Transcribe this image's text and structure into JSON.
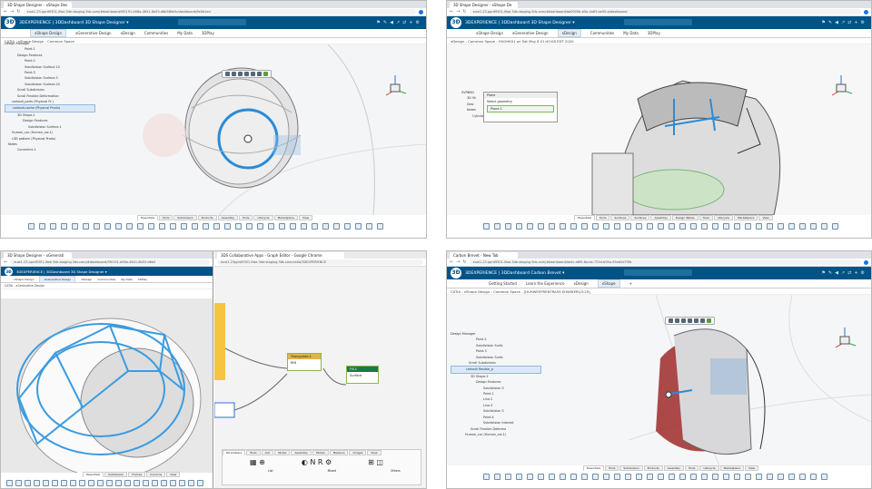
{
  "q1": {
    "browser_tab": "3D Shape Designer - xShape Des",
    "url": "euw1-23.pprd9301-ifwe.3de.staging.3ds.com/#dashboard/5f0191-b56a-4641-8a53-d6b58fa9c/dashboard/6e0b1ed",
    "brand": "3DEXPERIENCE | 3DDashboard  3D Shape Designer ▾",
    "tabs": [
      "xShape Design",
      "xGenerative Design",
      "xDesign",
      "Communities",
      "My Data",
      "3DPlay"
    ],
    "active_tab": "xShape Design",
    "subbar": "CATIA - xShape Design - Common Space",
    "tree": [
      "Design Manager",
      "Point.1",
      "Design Features",
      "Point.2",
      "Subdivision Surface.14",
      "Point.3",
      "Subdivision Surface.3",
      "Subdivision Surface.24",
      "Scroll Subdivision",
      "Scroll Flexible Deformation",
      "carbodi_parts (Physical Pr.)",
      "carbodi-cache (Physical Produ)",
      "3D Shape.1",
      "Design Features",
      "Subdivision Surface.1",
      "Human_car (Human_car.1)",
      "c3D pattern (Physical Produ)",
      "Notes",
      "Cornerlink.1"
    ],
    "bottom_tabs": [
      "Essentials",
      "Tools",
      "Subdivision",
      "Products",
      "Assembly",
      "Tools",
      "Lifecycle",
      "Marketplace",
      "View"
    ]
  },
  "q2": {
    "browser_tab": "3D Shape Designer - xShape De",
    "url": "euw1-23.pprd9301-ifwe.3de.staging.3ds.com/#dashboard/da9005b-b5a-4a63-ae90-e/dashboard",
    "brand": "3DEXPERIENCE | 3DDashboard  3D Shape Designer ▾",
    "tabs": [
      "xShape Design",
      "xGenerative Design",
      "xDesign",
      "Communities",
      "My Data",
      "3DPlay"
    ],
    "active_tab": "xDesign",
    "subbar": "xDesign - Common Space - HUGHK01 on Sat May 8 01:40:08 EDT 2020",
    "tree": [
      "SVRB0D",
      "3D Sh",
      "Desi",
      "Notes",
      "Cylinder.1"
    ],
    "panel_title": "Plane",
    "panel_rows": [
      "Select geometry",
      "Plane.1"
    ],
    "bottom_tabs": [
      "Essentials",
      "Tools",
      "Surfaces",
      "Surfaces",
      "Assembly",
      "Design Tables",
      "Tools",
      "Lifecycle",
      "Marketplace",
      "View"
    ]
  },
  "q3": {
    "browser_tab": "3D Shape Designer - xGenerati",
    "url": "euw1-23.pprd9301-ifwe.3de.staging.3ds.com/#dashboard/5f0191-b56a-4641-8a53-d6b5",
    "brand": "3DEXPERIENCE | 3DDashboard  3D Shape Designer ▾",
    "tabs": [
      "xShape Design",
      "xGenerative Design",
      "xDesign",
      "Communities",
      "My Data",
      "3DPlay"
    ],
    "active_tab": "xGenerative Design",
    "subbar": "CATIA - xGenerative Design",
    "graph_window_tab": "3DS Collaborative Apps - Graph Editor - Google Chrome",
    "graph_url": "euw1-23pprd9301-ifwe.3de.staging.3ds.com/catia/3DEXPERIENCE",
    "nodes": [
      {
        "title": "Triangulate.1",
        "label": "RIN"
      },
      {
        "title": "Fill.1",
        "label": "Surface"
      }
    ],
    "bottom_tabs": [
      "Parameters",
      "Tools",
      "List",
      "Vertex",
      "Assembly",
      "Modes",
      "Measure",
      "Images",
      "View"
    ],
    "panel_groups": [
      "List",
      "Mixed",
      "Others"
    ],
    "bottom_tabs_left": [
      "Essentials",
      "Subdivision",
      "Frames",
      "Columns",
      "View"
    ]
  },
  "q4": {
    "browser_tab": "Carbon Brevet - New Tab",
    "url": "euw1-23.pprd9301-ifwe.3de.staging.3ds.com/#dashboard/da4c-a8f5-8a-ee-725d-b05a-55ed2d7f3b",
    "brand": "3DEXPERIENCE | 3DDashboard  Carbon Brevet ▾",
    "tabs": [
      "Getting Started",
      "Learn the Experience",
      "xDesign",
      "xShape"
    ],
    "active_tab": "xShape",
    "subbar": "CATIA - xShape Design - Common Space - [HUHWEEPRENTRA59 EHWWERQ3:29]",
    "tree": [
      "Design Manager",
      "Point.2",
      "Subdivision Surfa",
      "Point.3",
      "Subdivision Surfa",
      "Scroll Subdivision",
      "carbodi flexible_p",
      "3D Shape.1",
      "Design Features",
      "Subdivision S",
      "Point.1",
      "Line.2",
      "Line.3",
      "Subdivision S",
      "Point.4",
      "Subdivision Interest",
      "Scroll Flexible Deforma",
      "Human_car (Human_car.1)"
    ],
    "bottom_tabs": [
      "Essentials",
      "Tools",
      "Subdivision",
      "Products",
      "Assembly",
      "Tools",
      "Lifecycle",
      "Marketplace",
      "View"
    ]
  }
}
